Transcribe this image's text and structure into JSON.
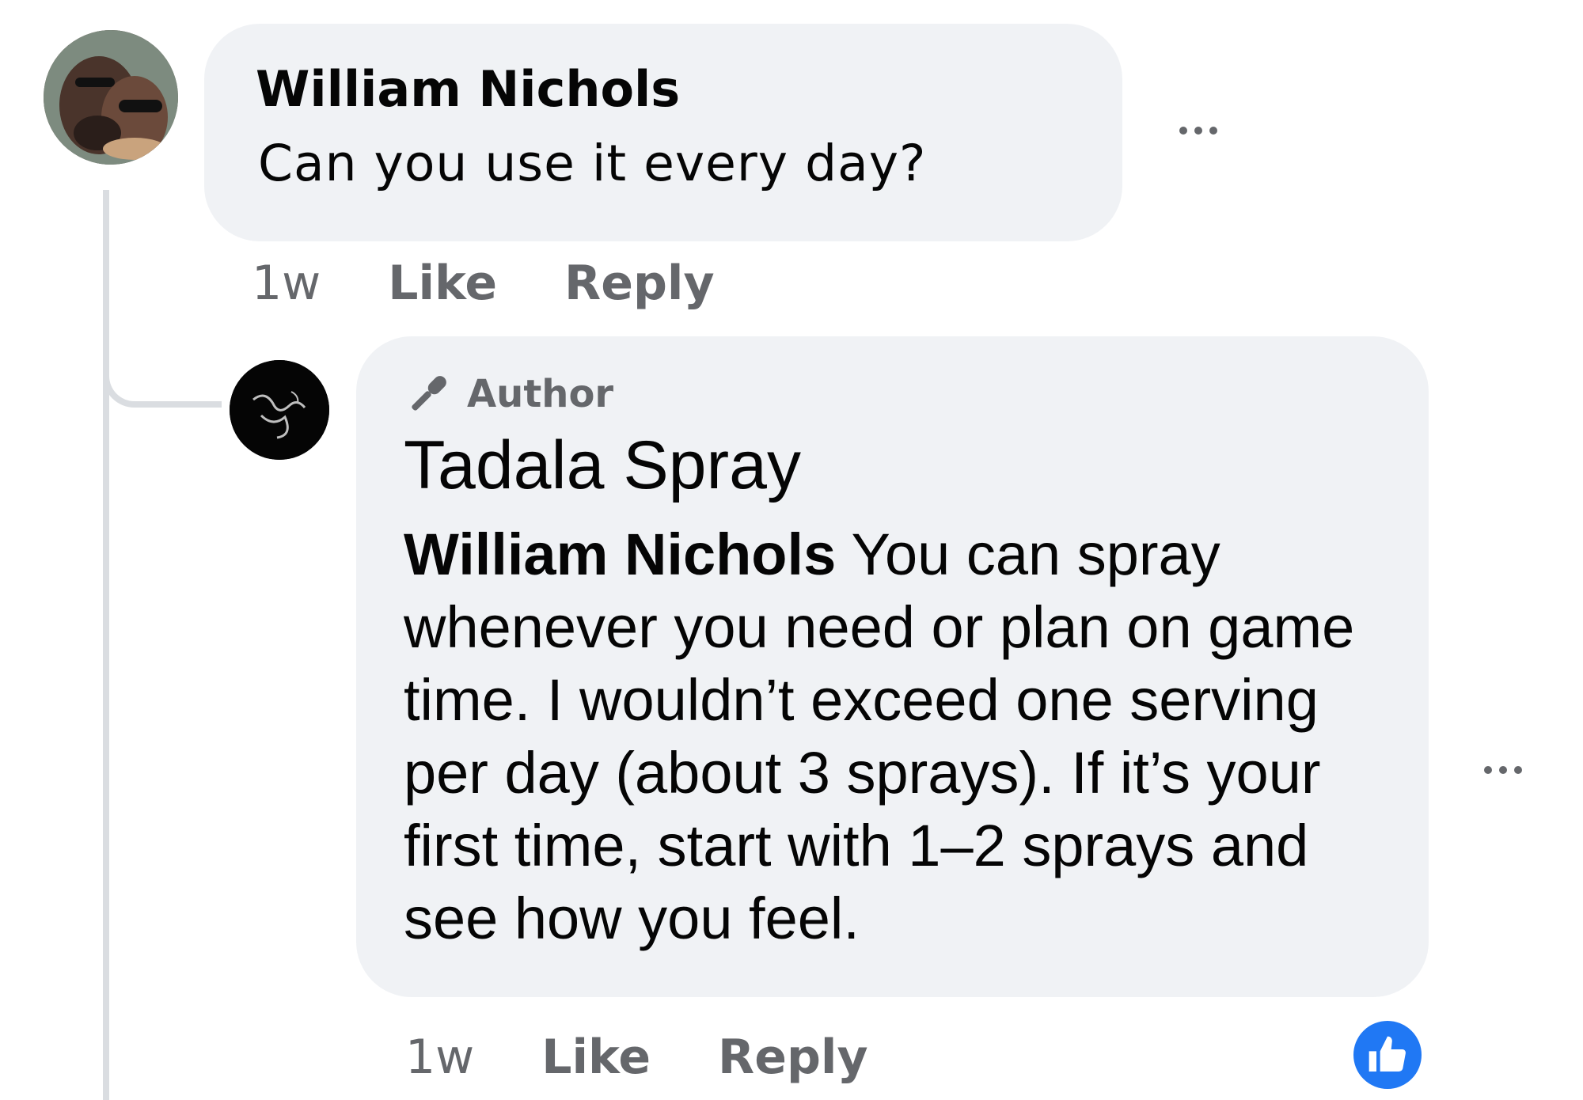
{
  "comments": [
    {
      "author": "William Nichols",
      "text": "Can you use it every day?",
      "timestamp": "1w",
      "like_label": "Like",
      "reply_label": "Reply"
    }
  ],
  "reply": {
    "badge": "Author",
    "author": "Tadala Spray",
    "mention": "William Nichols",
    "text": " You can spray whenever you need or plan on game time. I wouldn’t exceed one serving per day (about 3 sprays). If it’s your first time, start with 1–2 sprays and see how you feel.",
    "timestamp": "1w",
    "like_label": "Like",
    "reply_label": "Reply",
    "reaction_icon": "thumbs-up-icon",
    "reaction_color": "#2078f4"
  },
  "colors": {
    "bubble_bg": "#f0f2f5",
    "secondary_text": "#65676b",
    "primary_text": "#050505",
    "thread_line": "#dadde1"
  }
}
